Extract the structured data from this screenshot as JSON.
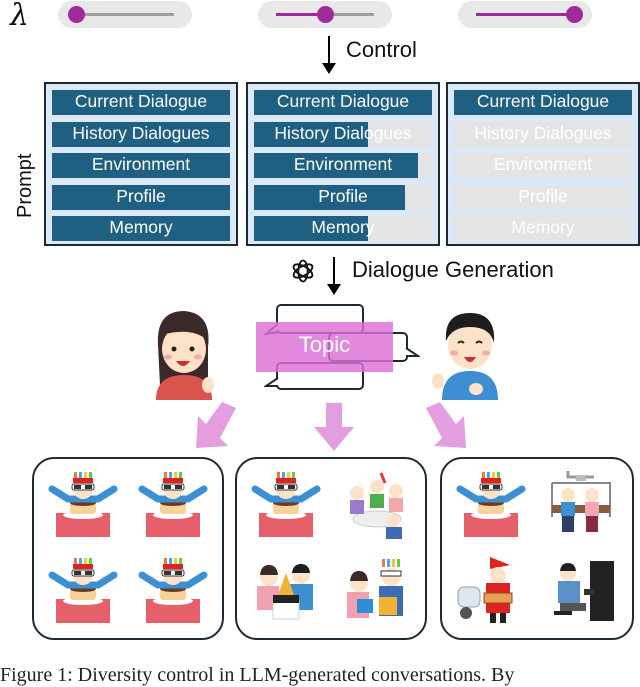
{
  "lambda_symbol": "λ",
  "sliders": [
    {
      "name": "low",
      "value": 0.0
    },
    {
      "name": "medium",
      "value": 0.5
    },
    {
      "name": "high",
      "value": 1.0
    }
  ],
  "colors": {
    "accent_purple": "#a0299b",
    "bar_blue": "#1e5f82",
    "bar_empty": "#e4e4e4",
    "panel_bg": "#dbe8f6",
    "topic_pink": "#da70d6",
    "arrow_pink": "#e39ee0"
  },
  "flow": {
    "control_label": "Control",
    "generation_label": "Dialogue Generation"
  },
  "prompt": {
    "axis_label": "Prompt",
    "panels": [
      {
        "name": "full",
        "items": [
          {
            "label": "Current Dialogue",
            "fill": 1.0
          },
          {
            "label": "History Dialogues",
            "fill": 1.0
          },
          {
            "label": "Environment",
            "fill": 1.0
          },
          {
            "label": "Profile",
            "fill": 1.0
          },
          {
            "label": "Memory",
            "fill": 1.0
          }
        ]
      },
      {
        "name": "partial",
        "items": [
          {
            "label": "Current Dialogue",
            "fill": 1.0
          },
          {
            "label": "History Dialogues",
            "fill": 0.64
          },
          {
            "label": "Environment",
            "fill": 0.92
          },
          {
            "label": "Profile",
            "fill": 0.85
          },
          {
            "label": "Memory",
            "fill": 0.64
          }
        ]
      },
      {
        "name": "minimal",
        "items": [
          {
            "label": "Current Dialogue",
            "fill": 1.0
          },
          {
            "label": "History Dialogues",
            "fill": 0.0
          },
          {
            "label": "Environment",
            "fill": 0.0
          },
          {
            "label": "Profile",
            "fill": 0.0
          },
          {
            "label": "Memory",
            "fill": 0.0
          }
        ]
      }
    ]
  },
  "topic": {
    "label": "Topic"
  },
  "icons": {
    "generator": "openai-logo-icon",
    "speaker_left": "woman-speaker-illustration",
    "speaker_right": "man-speaker-illustration"
  },
  "outputs": [
    {
      "name": "low-diversity",
      "scenes": [
        "birthday-boy",
        "birthday-boy",
        "birthday-boy",
        "birthday-boy"
      ]
    },
    {
      "name": "medium-diversity",
      "scenes": [
        "birthday-boy",
        "party-group",
        "birthday-cake-couple",
        "gift-exchange"
      ]
    },
    {
      "name": "high-diversity",
      "scenes": [
        "birthday-boy",
        "ski-lift-couple",
        "santa-pizza-delivery",
        "piano-player"
      ]
    }
  ],
  "caption": "Figure 1: Diversity control in LLM-generated conversations. By"
}
